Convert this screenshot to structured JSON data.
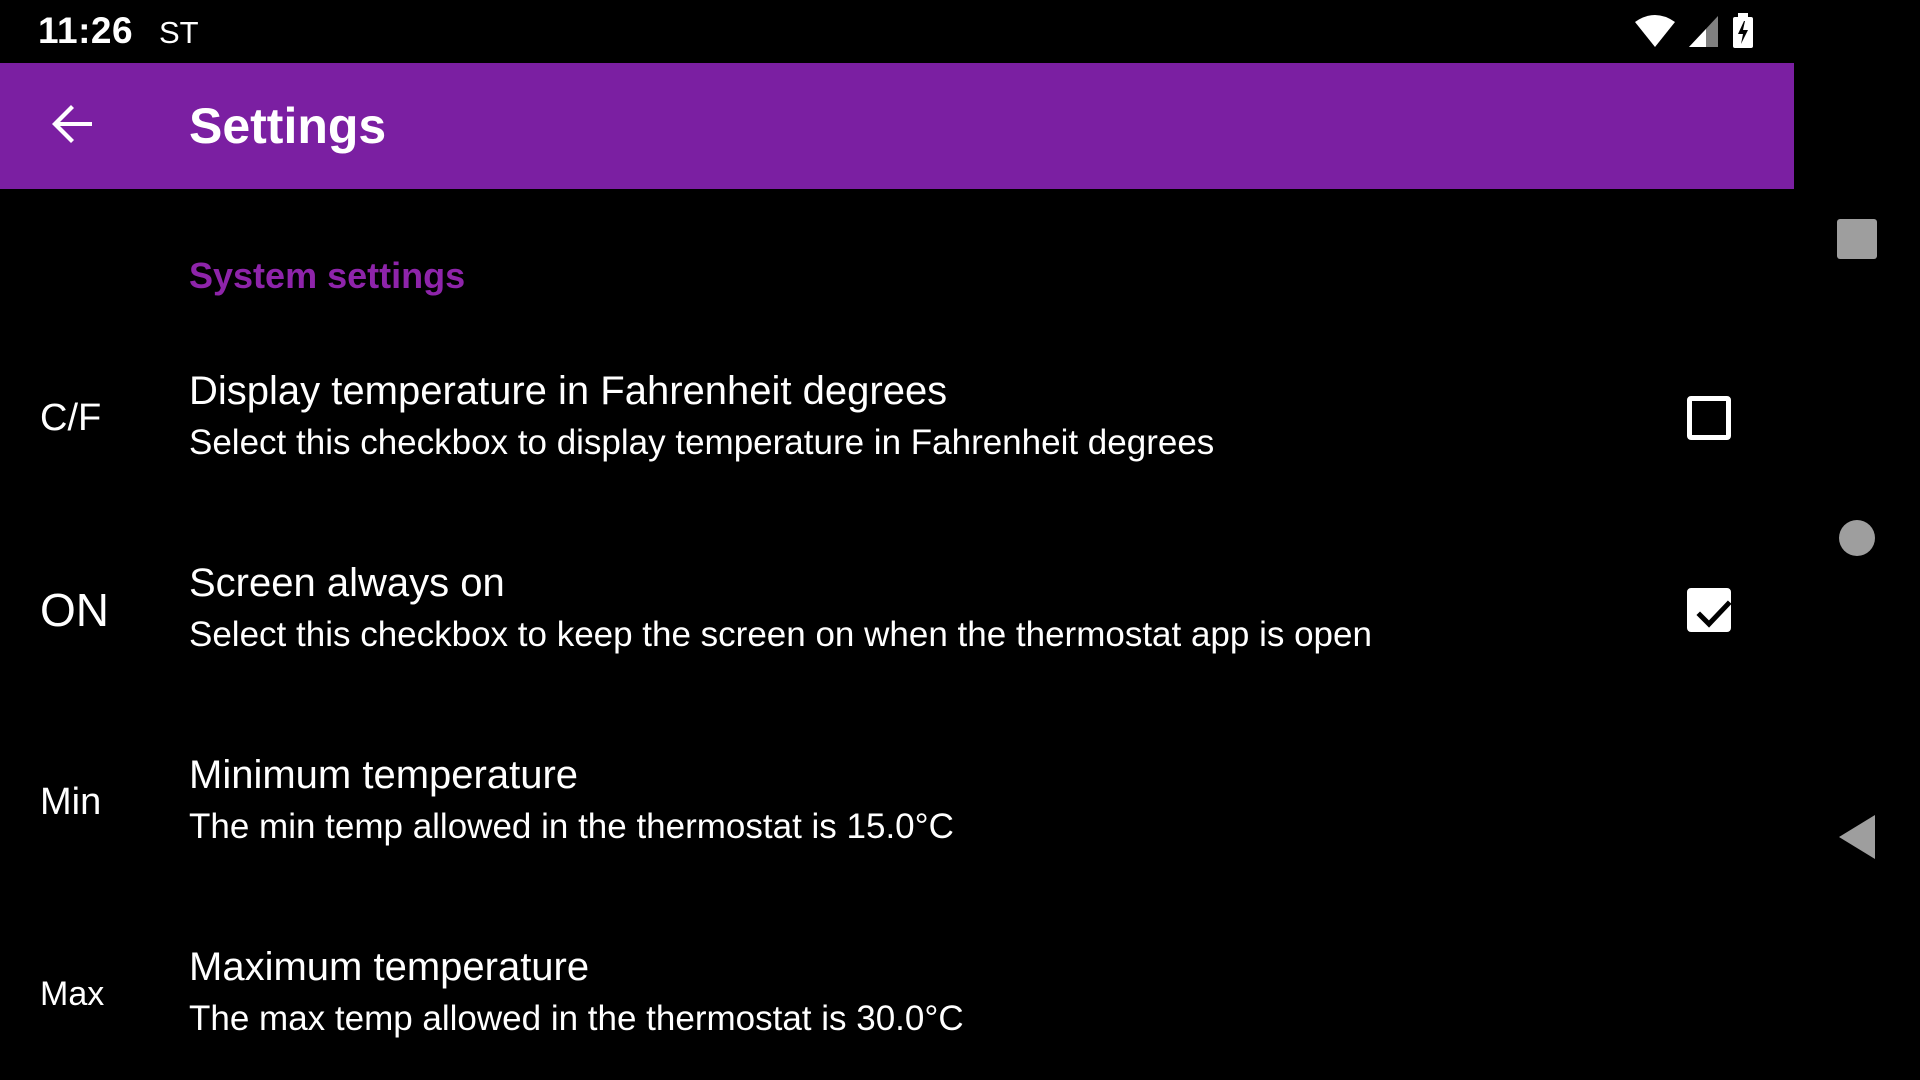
{
  "status_bar": {
    "time": "11:26",
    "carrier": "ST",
    "icons": [
      "wifi-icon",
      "cell-signal-icon",
      "battery-charging-icon"
    ]
  },
  "app_bar": {
    "title": "Settings",
    "back_icon": "arrow-back-icon",
    "color": "#7b1fa2"
  },
  "category": {
    "title": "System settings",
    "color": "#8e24aa"
  },
  "preferences": [
    {
      "icon_text": "C/F",
      "title": "Display temperature in Fahrenheit degrees",
      "summary": "Select this checkbox to display temperature in Fahrenheit degrees",
      "checked": false
    },
    {
      "icon_text": "ON",
      "title": "Screen always on",
      "summary": "Select this checkbox to keep the screen on when the thermostat app is open",
      "checked": true
    },
    {
      "icon_text": "Min",
      "title": "Minimum temperature",
      "summary": "The min temp allowed in the thermostat is 15.0°C"
    },
    {
      "icon_text": "Max",
      "title": "Maximum temperature",
      "summary": "The max temp allowed in the thermostat is 30.0°C"
    }
  ],
  "nav_bar": {
    "buttons": [
      "recents-square-icon",
      "home-circle-icon",
      "back-triangle-icon"
    ]
  }
}
